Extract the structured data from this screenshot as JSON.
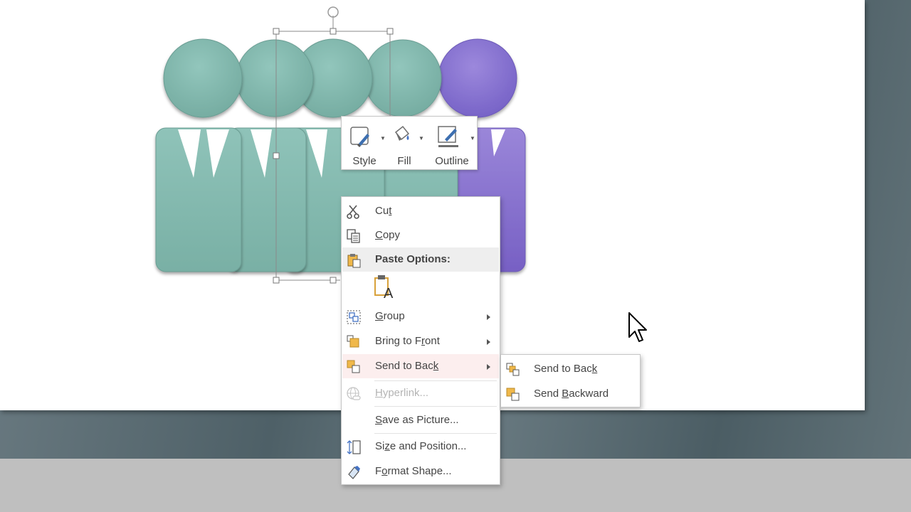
{
  "mini_toolbar": {
    "style_label": "Style",
    "fill_label": "Fill",
    "outline_label": "Outline"
  },
  "context_menu": {
    "cut": {
      "pre": "Cu",
      "key": "t",
      "post": ""
    },
    "copy": {
      "pre": "",
      "key": "C",
      "post": "opy"
    },
    "paste_options_label": "Paste Options:",
    "group": {
      "pre": "",
      "key": "G",
      "post": "roup"
    },
    "bring_to_front": {
      "pre": "Bring to F",
      "key": "r",
      "post": "ont"
    },
    "send_to_back": {
      "pre": "Send to Bac",
      "key": "k",
      "post": ""
    },
    "hyperlink": {
      "pre": "",
      "key": "H",
      "post": "yperlink..."
    },
    "save_as_picture": {
      "pre": "",
      "key": "S",
      "post": "ave as Picture..."
    },
    "size_and_position": {
      "pre": "Si",
      "key": "z",
      "post": "e and Position..."
    },
    "format_shape": {
      "pre": "F",
      "key": "o",
      "post": "rmat Shape..."
    }
  },
  "submenu": {
    "send_to_back": {
      "pre": "Send to Bac",
      "key": "k",
      "post": ""
    },
    "send_backward": {
      "pre": "Send ",
      "key": "B",
      "post": "ackward"
    }
  },
  "colors": {
    "teal_shape": "#86bdb2",
    "purple_shape": "#8a72cf",
    "menu_highlight": "#fceeee",
    "icon_orange": "#f0b84a"
  },
  "icons": {
    "cut": "scissors-icon",
    "copy": "copy-icon",
    "paste": "paste-icon",
    "keep_text_only": "keep-text-only-icon",
    "group": "group-icon",
    "bring_to_front": "bring-to-front-icon",
    "send_to_back": "send-to-back-icon",
    "hyperlink": "hyperlink-icon",
    "size_position": "size-position-icon",
    "format_shape": "format-shape-icon",
    "send_backward": "send-backward-icon",
    "cursor": "mouse-pointer-icon"
  }
}
